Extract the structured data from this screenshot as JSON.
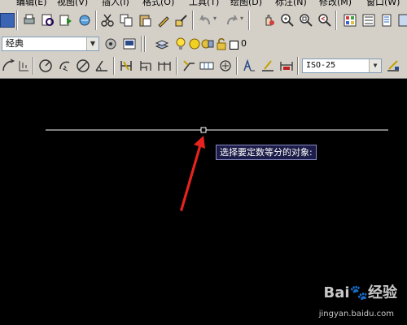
{
  "menubar": {
    "items": [
      "编辑(E)",
      "视图(V)",
      "插入(I)",
      "格式(O)",
      "工具(T)",
      "绘图(D)",
      "标注(N)",
      "修改(M)",
      "窗口(W)"
    ]
  },
  "workspace": {
    "value": "经典"
  },
  "layer": {
    "value": "0"
  },
  "dimstyle": {
    "value": "ISO-25"
  },
  "command_tooltip": {
    "text": "选择要定数等分的对象:"
  },
  "watermark": {
    "brand": "Bai🐾经验",
    "url": "jingyan.baidu.com"
  },
  "colors": {
    "toolbar_bg": "#d4d0c8",
    "canvas_bg": "#000000",
    "line": "#ffffff",
    "annotation_arrow": "#e8231f",
    "tooltip_bg": "#1c1c48"
  }
}
